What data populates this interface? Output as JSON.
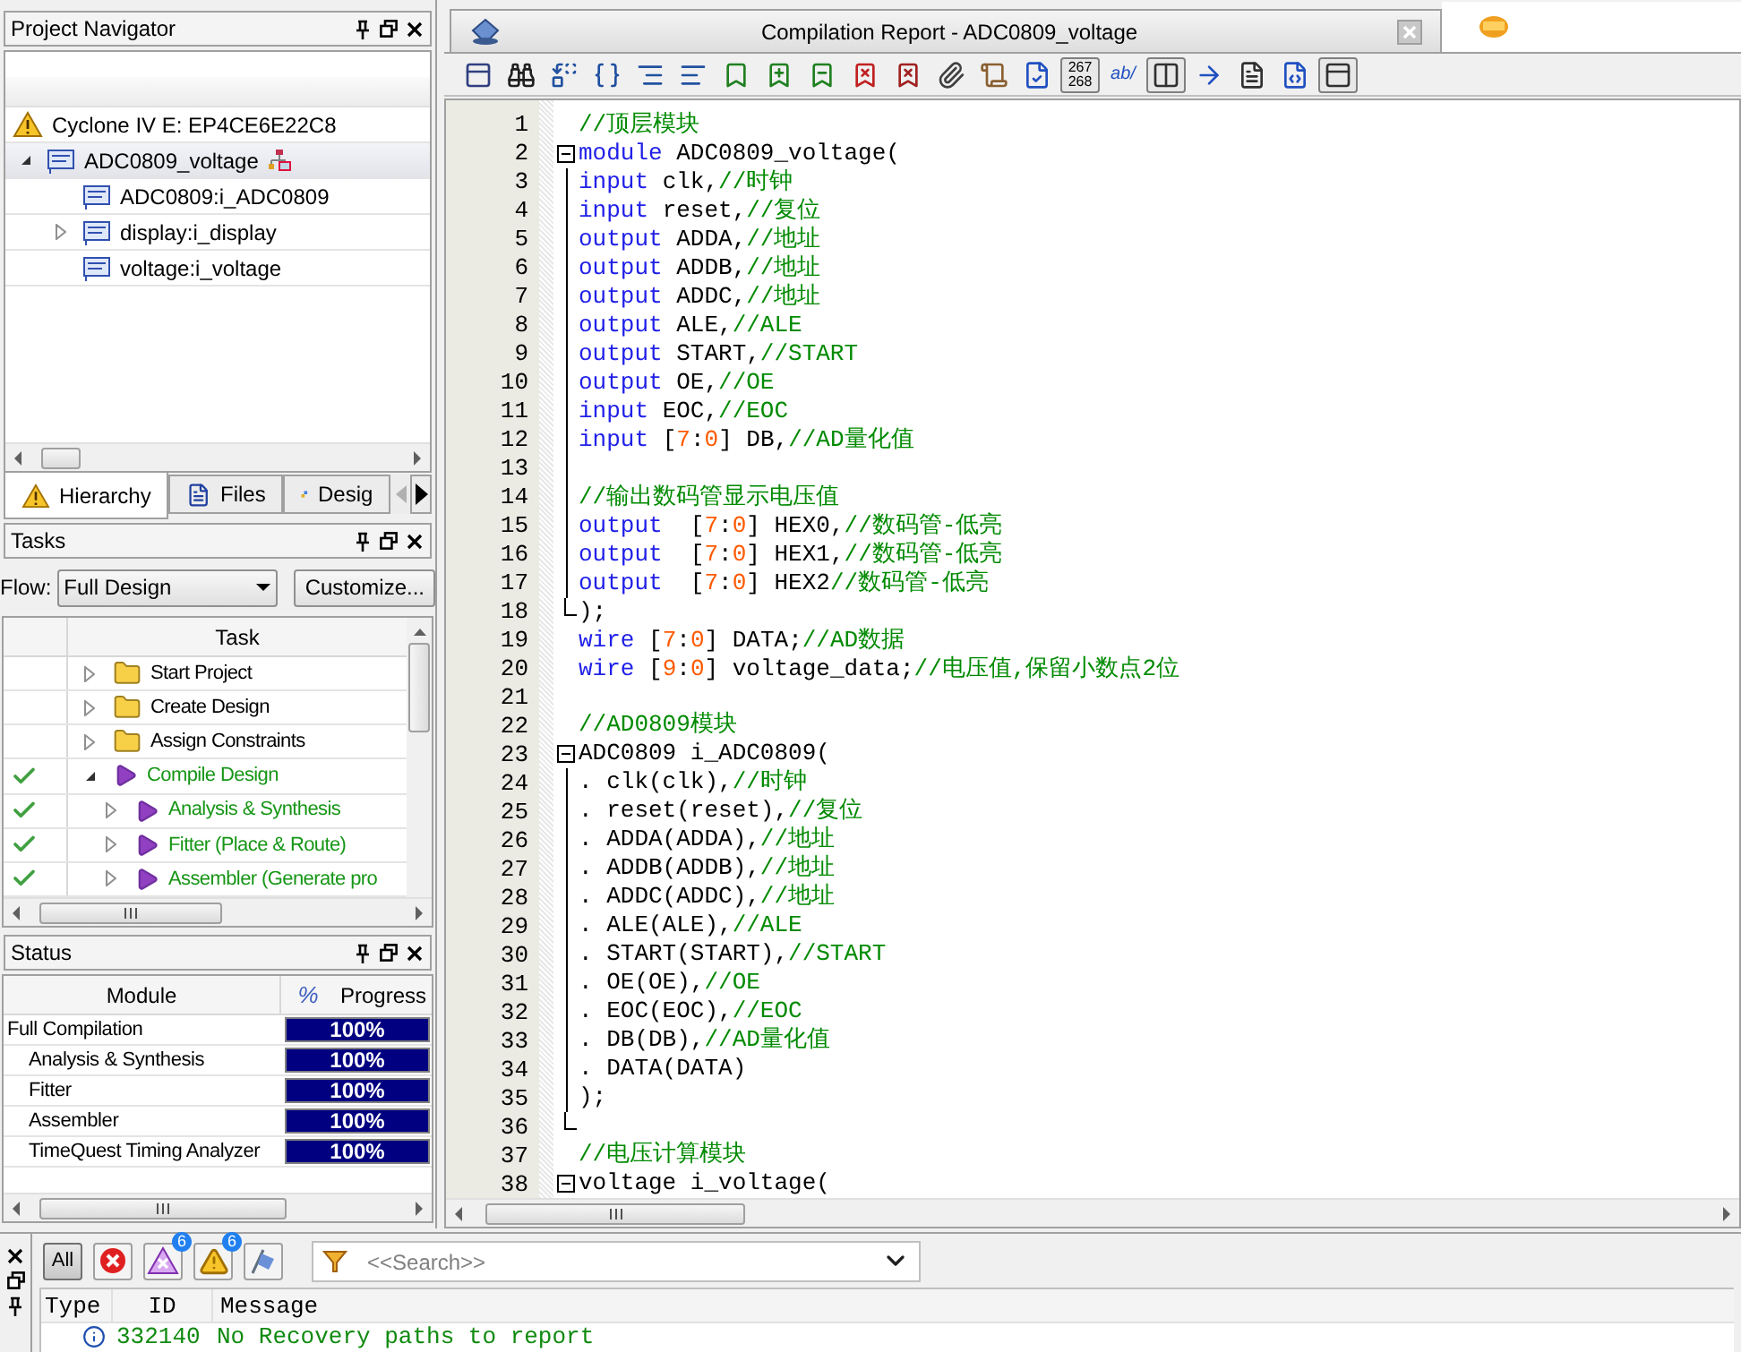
{
  "project_navigator": {
    "title": "Project Navigator",
    "tree": [
      {
        "label": "Cyclone IV E: EP4CE6E22C8",
        "kind": "device",
        "selected": false
      },
      {
        "label": "ADC0809_voltage",
        "kind": "entity",
        "expanded": true,
        "selected": true,
        "children": [
          {
            "label": "ADC0809:i_ADC0809",
            "kind": "entity",
            "selected": false
          },
          {
            "label": "display:i_display",
            "kind": "entity",
            "expanded": false,
            "selected": false
          },
          {
            "label": "voltage:i_voltage",
            "kind": "entity",
            "selected": false
          }
        ]
      }
    ],
    "tabs": [
      {
        "label": "Hierarchy",
        "kind": "hierarchy",
        "selected": true
      },
      {
        "label": "Files",
        "kind": "files",
        "selected": false
      },
      {
        "label": "Desig",
        "kind": "design",
        "selected": false
      }
    ]
  },
  "tasks": {
    "title": "Tasks",
    "flow_label": "Flow:",
    "flow_value": "Full Design",
    "customize_button": "Customize...",
    "column": "Task",
    "items": [
      {
        "label": "Start Project",
        "kind": "folder",
        "done": false,
        "expanded": false
      },
      {
        "label": "Create Design",
        "kind": "folder",
        "done": false,
        "expanded": false
      },
      {
        "label": "Assign Constraints",
        "kind": "folder",
        "done": false,
        "expanded": false
      },
      {
        "label": "Compile Design",
        "kind": "task",
        "done": true,
        "expanded": true,
        "children": [
          {
            "label": "Analysis & Synthesis",
            "kind": "task",
            "done": true,
            "expanded": false
          },
          {
            "label": "Fitter (Place & Route)",
            "kind": "task",
            "done": true,
            "expanded": false
          },
          {
            "label": "Assembler (Generate pro",
            "kind": "task",
            "done": true,
            "expanded": false
          }
        ]
      }
    ]
  },
  "status": {
    "title": "Status",
    "columns": [
      "Module",
      "%",
      "Progress"
    ],
    "rows": [
      {
        "module": "Full Compilation",
        "level": 1,
        "progress": "100%",
        "children": [
          {
            "module": "Analysis & Synthesis",
            "level": 1,
            "progress": "100%"
          },
          {
            "module": "Fitter",
            "level": 1,
            "progress": "100%"
          },
          {
            "module": "Assembler",
            "level": 1,
            "progress": "100%"
          },
          {
            "module": "TimeQuest Timing Analyzer",
            "level": 1,
            "progress": "100%"
          }
        ]
      }
    ]
  },
  "editor": {
    "tab_title": "Compilation Report - ADC0809_voltage",
    "line_numbers_button": [
      "267",
      "268"
    ],
    "wrap_button": "ab/",
    "lines": [
      {
        "number": "1",
        "tokens": [
          {
            "kind": "comment",
            "text": "//顶层模块"
          }
        ]
      },
      {
        "number": "2",
        "expanded": true,
        "tokens": [
          {
            "kind": "keyword",
            "text": "module"
          },
          {
            "kind": "plain",
            "text": " ADC0809_voltage("
          }
        ],
        "children": [
          {
            "number": "3",
            "tokens": [
              {
                "kind": "keyword",
                "text": "input"
              },
              {
                "kind": "plain",
                "text": " clk,"
              },
              {
                "kind": "comment",
                "text": "//时钟"
              }
            ]
          },
          {
            "number": "4",
            "tokens": [
              {
                "kind": "keyword",
                "text": "input"
              },
              {
                "kind": "plain",
                "text": " reset,"
              },
              {
                "kind": "comment",
                "text": "//复位"
              }
            ]
          },
          {
            "number": "5",
            "tokens": [
              {
                "kind": "keyword",
                "text": "output"
              },
              {
                "kind": "plain",
                "text": " ADDA,"
              },
              {
                "kind": "comment",
                "text": "//地址"
              }
            ]
          },
          {
            "number": "6",
            "tokens": [
              {
                "kind": "keyword",
                "text": "output"
              },
              {
                "kind": "plain",
                "text": " ADDB,"
              },
              {
                "kind": "comment",
                "text": "//地址"
              }
            ]
          },
          {
            "number": "7",
            "tokens": [
              {
                "kind": "keyword",
                "text": "output"
              },
              {
                "kind": "plain",
                "text": " ADDC,"
              },
              {
                "kind": "comment",
                "text": "//地址"
              }
            ]
          },
          {
            "number": "8",
            "tokens": [
              {
                "kind": "keyword",
                "text": "output"
              },
              {
                "kind": "plain",
                "text": " ALE,"
              },
              {
                "kind": "comment",
                "text": "//ALE"
              }
            ]
          },
          {
            "number": "9",
            "tokens": [
              {
                "kind": "keyword",
                "text": "output"
              },
              {
                "kind": "plain",
                "text": " START,"
              },
              {
                "kind": "comment",
                "text": "//START"
              }
            ]
          },
          {
            "number": "10",
            "tokens": [
              {
                "kind": "keyword",
                "text": "output"
              },
              {
                "kind": "plain",
                "text": " OE,"
              },
              {
                "kind": "comment",
                "text": "//OE"
              }
            ]
          },
          {
            "number": "11",
            "tokens": [
              {
                "kind": "keyword",
                "text": "input"
              },
              {
                "kind": "plain",
                "text": " EOC,"
              },
              {
                "kind": "comment",
                "text": "//EOC"
              }
            ]
          },
          {
            "number": "12",
            "tokens": [
              {
                "kind": "keyword",
                "text": "input"
              },
              {
                "kind": "plain",
                "text": " ["
              },
              {
                "kind": "number",
                "text": "7"
              },
              {
                "kind": "plain",
                "text": ":"
              },
              {
                "kind": "number",
                "text": "0"
              },
              {
                "kind": "plain",
                "text": "] DB,"
              },
              {
                "kind": "comment",
                "text": "//AD量化值"
              }
            ]
          },
          {
            "number": "13"
          },
          {
            "number": "14",
            "tokens": [
              {
                "kind": "comment",
                "text": "//输出数码管显示电压值"
              }
            ]
          },
          {
            "number": "15",
            "tokens": [
              {
                "kind": "keyword",
                "text": "output"
              },
              {
                "kind": "plain",
                "text": "  ["
              },
              {
                "kind": "number",
                "text": "7"
              },
              {
                "kind": "plain",
                "text": ":"
              },
              {
                "kind": "number",
                "text": "0"
              },
              {
                "kind": "plain",
                "text": "] HEX0,"
              },
              {
                "kind": "comment",
                "text": "//数码管-低亮"
              }
            ]
          },
          {
            "number": "16",
            "tokens": [
              {
                "kind": "keyword",
                "text": "output"
              },
              {
                "kind": "plain",
                "text": "  ["
              },
              {
                "kind": "number",
                "text": "7"
              },
              {
                "kind": "plain",
                "text": ":"
              },
              {
                "kind": "number",
                "text": "0"
              },
              {
                "kind": "plain",
                "text": "] HEX1,"
              },
              {
                "kind": "comment",
                "text": "//数码管-低亮"
              }
            ]
          },
          {
            "number": "17",
            "tokens": [
              {
                "kind": "keyword",
                "text": "output"
              },
              {
                "kind": "plain",
                "text": "  ["
              },
              {
                "kind": "number",
                "text": "7"
              },
              {
                "kind": "plain",
                "text": ":"
              },
              {
                "kind": "number",
                "text": "0"
              },
              {
                "kind": "plain",
                "text": "] HEX2"
              },
              {
                "kind": "comment",
                "text": "//数码管-低亮"
              }
            ]
          },
          {
            "number": "18",
            "tokens": [
              {
                "kind": "plain",
                "text": ");"
              }
            ]
          }
        ]
      },
      {
        "number": "19",
        "tokens": [
          {
            "kind": "keyword",
            "text": "wire"
          },
          {
            "kind": "plain",
            "text": " ["
          },
          {
            "kind": "number",
            "text": "7"
          },
          {
            "kind": "plain",
            "text": ":"
          },
          {
            "kind": "number",
            "text": "0"
          },
          {
            "kind": "plain",
            "text": "] DATA;"
          },
          {
            "kind": "comment",
            "text": "//AD数据"
          }
        ]
      },
      {
        "number": "20",
        "tokens": [
          {
            "kind": "keyword",
            "text": "wire"
          },
          {
            "kind": "plain",
            "text": " ["
          },
          {
            "kind": "number",
            "text": "9"
          },
          {
            "kind": "plain",
            "text": ":"
          },
          {
            "kind": "number",
            "text": "0"
          },
          {
            "kind": "plain",
            "text": "] voltage_data;"
          },
          {
            "kind": "comment",
            "text": "//电压值,保留小数点2位"
          }
        ]
      },
      {
        "number": "21"
      },
      {
        "number": "22",
        "tokens": [
          {
            "kind": "comment",
            "text": "//AD0809模块"
          }
        ]
      },
      {
        "number": "23",
        "expanded": true,
        "tokens": [
          {
            "kind": "plain",
            "text": "ADC0809 i_ADC0809("
          }
        ],
        "children": [
          {
            "number": "24",
            "tokens": [
              {
                "kind": "plain",
                "text": ". clk(clk),"
              },
              {
                "kind": "comment",
                "text": "//时钟"
              }
            ]
          },
          {
            "number": "25",
            "tokens": [
              {
                "kind": "plain",
                "text": ". reset(reset),"
              },
              {
                "kind": "comment",
                "text": "//复位"
              }
            ]
          },
          {
            "number": "26",
            "tokens": [
              {
                "kind": "plain",
                "text": ". ADDA(ADDA),"
              },
              {
                "kind": "comment",
                "text": "//地址"
              }
            ]
          },
          {
            "number": "27",
            "tokens": [
              {
                "kind": "plain",
                "text": ". ADDB(ADDB),"
              },
              {
                "kind": "comment",
                "text": "//地址"
              }
            ]
          },
          {
            "number": "28",
            "tokens": [
              {
                "kind": "plain",
                "text": ". ADDC(ADDC),"
              },
              {
                "kind": "comment",
                "text": "//地址"
              }
            ]
          },
          {
            "number": "29",
            "tokens": [
              {
                "kind": "plain",
                "text": ". ALE(ALE),"
              },
              {
                "kind": "comment",
                "text": "//ALE"
              }
            ]
          },
          {
            "number": "30",
            "tokens": [
              {
                "kind": "plain",
                "text": ". START(START),"
              },
              {
                "kind": "comment",
                "text": "//START"
              }
            ]
          },
          {
            "number": "31",
            "tokens": [
              {
                "kind": "plain",
                "text": ". OE(OE),"
              },
              {
                "kind": "comment",
                "text": "//OE"
              }
            ]
          },
          {
            "number": "32",
            "tokens": [
              {
                "kind": "plain",
                "text": ". EOC(EOC),"
              },
              {
                "kind": "comment",
                "text": "//EOC"
              }
            ]
          },
          {
            "number": "33",
            "tokens": [
              {
                "kind": "plain",
                "text": ". DB(DB),"
              },
              {
                "kind": "comment",
                "text": "//AD量化值"
              }
            ]
          },
          {
            "number": "34",
            "tokens": [
              {
                "kind": "plain",
                "text": ". DATA(DATA)"
              }
            ]
          },
          {
            "number": "35",
            "tokens": [
              {
                "kind": "plain",
                "text": ");"
              }
            ]
          },
          {
            "number": "36"
          }
        ]
      },
      {
        "number": "37",
        "tokens": [
          {
            "kind": "comment",
            "text": "//电压计算模块"
          }
        ]
      },
      {
        "number": "38",
        "expanded": true,
        "tokens": [
          {
            "kind": "plain",
            "text": "voltage i_voltage("
          }
        ]
      }
    ]
  },
  "messages": {
    "filters": [
      {
        "kind": "all",
        "label": "All",
        "selected": true
      },
      {
        "kind": "error",
        "selected": false
      },
      {
        "kind": "critical",
        "badge": "6",
        "selected": false
      },
      {
        "kind": "warning",
        "badge": "6",
        "selected": false
      },
      {
        "kind": "suppressed",
        "selected": false
      }
    ],
    "search": {
      "placeholder": "<<Search>>"
    },
    "columns": [
      "Type",
      "ID",
      "Message"
    ],
    "rows": [
      {
        "kind": "info",
        "id": "332140",
        "message": "No Recovery paths to report"
      }
    ]
  }
}
